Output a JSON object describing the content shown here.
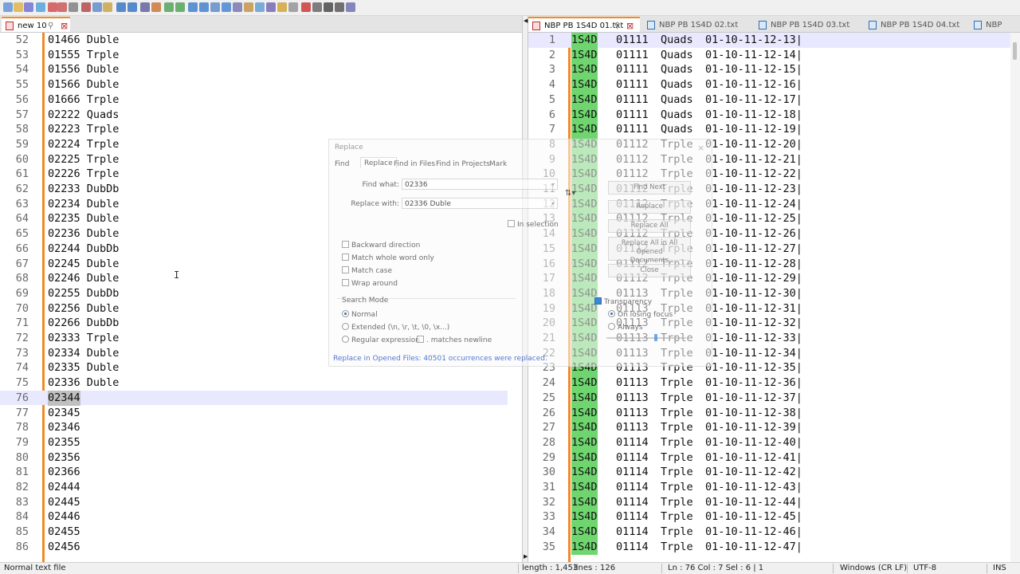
{
  "colors": {
    "accent_orange": "#f08a24",
    "highlight_green": "#6fd66f",
    "status_blue": "#3758c8",
    "current_line": "#e8e8ff"
  },
  "toolbar": {
    "icons": [
      "new-file-icon",
      "open-file-icon",
      "save-icon",
      "save-all-icon",
      "close-icon",
      "close-all-icon",
      "print-icon",
      "cut-icon",
      "copy-icon",
      "paste-icon",
      "undo-icon",
      "redo-icon",
      "find-icon",
      "replace-icon",
      "zoom-in-icon",
      "zoom-out-icon",
      "sync-vertical-icon",
      "sync-horizontal-icon",
      "word-wrap-icon",
      "show-all-chars-icon",
      "indent-guide-icon",
      "language-icon",
      "doc-map-icon",
      "function-list-icon",
      "folder-workspace-icon",
      "monitoring-icon",
      "record-macro-icon",
      "stop-macro-icon",
      "play-macro-icon",
      "run-macro-icon",
      "save-macro-icon"
    ]
  },
  "left_tabs": [
    {
      "label": "new 10",
      "active": true
    }
  ],
  "right_tabs": [
    {
      "label": "NBP PB 1S4D 01.txt",
      "active": true
    },
    {
      "label": "NBP PB 1S4D 02.txt",
      "active": false
    },
    {
      "label": "NBP PB 1S4D 03.txt",
      "active": false
    },
    {
      "label": "NBP PB 1S4D 04.txt",
      "active": false
    },
    {
      "label": "NBP",
      "active": false
    }
  ],
  "left_editor": {
    "current_line": "76",
    "lines": [
      {
        "n": "52",
        "text": "01466 Duble"
      },
      {
        "n": "53",
        "text": "01555 Trple"
      },
      {
        "n": "54",
        "text": "01556 Duble"
      },
      {
        "n": "55",
        "text": "01566 Duble"
      },
      {
        "n": "56",
        "text": "01666 Trple"
      },
      {
        "n": "57",
        "text": "02222 Quads"
      },
      {
        "n": "58",
        "text": "02223 Trple"
      },
      {
        "n": "59",
        "text": "02224 Trple"
      },
      {
        "n": "60",
        "text": "02225 Trple"
      },
      {
        "n": "61",
        "text": "02226 Trple"
      },
      {
        "n": "62",
        "text": "02233 DubDb"
      },
      {
        "n": "63",
        "text": "02234 Duble"
      },
      {
        "n": "64",
        "text": "02235 Duble"
      },
      {
        "n": "65",
        "text": "02236 Duble"
      },
      {
        "n": "66",
        "text": "02244 DubDb"
      },
      {
        "n": "67",
        "text": "02245 Duble"
      },
      {
        "n": "68",
        "text": "02246 Duble"
      },
      {
        "n": "69",
        "text": "02255 DubDb"
      },
      {
        "n": "70",
        "text": "02256 Duble"
      },
      {
        "n": "71",
        "text": "02266 DubDb"
      },
      {
        "n": "72",
        "text": "02333 Trple"
      },
      {
        "n": "73",
        "text": "02334 Duble"
      },
      {
        "n": "74",
        "text": "02335 Duble"
      },
      {
        "n": "75",
        "text": "02336 Duble"
      },
      {
        "n": "76",
        "text": "02344"
      },
      {
        "n": "77",
        "text": "02345"
      },
      {
        "n": "78",
        "text": "02346"
      },
      {
        "n": "79",
        "text": "02355"
      },
      {
        "n": "80",
        "text": "02356"
      },
      {
        "n": "81",
        "text": "02366"
      },
      {
        "n": "82",
        "text": "02444"
      },
      {
        "n": "83",
        "text": "02445"
      },
      {
        "n": "84",
        "text": "02446"
      },
      {
        "n": "85",
        "text": "02455"
      },
      {
        "n": "86",
        "text": "02456"
      }
    ]
  },
  "right_editor": {
    "prefix": "1S4D",
    "lines": [
      {
        "n": "1",
        "code": "01111",
        "kind": "Quads",
        "seq": "01-10-11-12-13|"
      },
      {
        "n": "2",
        "code": "01111",
        "kind": "Quads",
        "seq": "01-10-11-12-14|"
      },
      {
        "n": "3",
        "code": "01111",
        "kind": "Quads",
        "seq": "01-10-11-12-15|"
      },
      {
        "n": "4",
        "code": "01111",
        "kind": "Quads",
        "seq": "01-10-11-12-16|"
      },
      {
        "n": "5",
        "code": "01111",
        "kind": "Quads",
        "seq": "01-10-11-12-17|"
      },
      {
        "n": "6",
        "code": "01111",
        "kind": "Quads",
        "seq": "01-10-11-12-18|"
      },
      {
        "n": "7",
        "code": "01111",
        "kind": "Quads",
        "seq": "01-10-11-12-19|"
      },
      {
        "n": "8",
        "code": "01112",
        "kind": "Trple",
        "seq": "01-10-11-12-20|"
      },
      {
        "n": "9",
        "code": "01112",
        "kind": "Trple",
        "seq": "01-10-11-12-21|"
      },
      {
        "n": "10",
        "code": "01112",
        "kind": "Trple",
        "seq": "01-10-11-12-22|"
      },
      {
        "n": "11",
        "code": "01112",
        "kind": "Trple",
        "seq": "01-10-11-12-23|"
      },
      {
        "n": "12",
        "code": "01112",
        "kind": "Trple",
        "seq": "01-10-11-12-24|"
      },
      {
        "n": "13",
        "code": "01112",
        "kind": "Trple",
        "seq": "01-10-11-12-25|"
      },
      {
        "n": "14",
        "code": "01112",
        "kind": "Trple",
        "seq": "01-10-11-12-26|"
      },
      {
        "n": "15",
        "code": "01112",
        "kind": "Trple",
        "seq": "01-10-11-12-27|"
      },
      {
        "n": "16",
        "code": "01112",
        "kind": "Trple",
        "seq": "01-10-11-12-28|"
      },
      {
        "n": "17",
        "code": "01112",
        "kind": "Trple",
        "seq": "01-10-11-12-29|"
      },
      {
        "n": "18",
        "code": "01113",
        "kind": "Trple",
        "seq": "01-10-11-12-30|"
      },
      {
        "n": "19",
        "code": "01113",
        "kind": "Trple",
        "seq": "01-10-11-12-31|"
      },
      {
        "n": "20",
        "code": "01113",
        "kind": "Trple",
        "seq": "01-10-11-12-32|"
      },
      {
        "n": "21",
        "code": "01113",
        "kind": "Trple",
        "seq": "01-10-11-12-33|"
      },
      {
        "n": "22",
        "code": "01113",
        "kind": "Trple",
        "seq": "01-10-11-12-34|"
      },
      {
        "n": "23",
        "code": "01113",
        "kind": "Trple",
        "seq": "01-10-11-12-35|"
      },
      {
        "n": "24",
        "code": "01113",
        "kind": "Trple",
        "seq": "01-10-11-12-36|"
      },
      {
        "n": "25",
        "code": "01113",
        "kind": "Trple",
        "seq": "01-10-11-12-37|"
      },
      {
        "n": "26",
        "code": "01113",
        "kind": "Trple",
        "seq": "01-10-11-12-38|"
      },
      {
        "n": "27",
        "code": "01113",
        "kind": "Trple",
        "seq": "01-10-11-12-39|"
      },
      {
        "n": "28",
        "code": "01114",
        "kind": "Trple",
        "seq": "01-10-11-12-40|"
      },
      {
        "n": "29",
        "code": "01114",
        "kind": "Trple",
        "seq": "01-10-11-12-41|"
      },
      {
        "n": "30",
        "code": "01114",
        "kind": "Trple",
        "seq": "01-10-11-12-42|"
      },
      {
        "n": "31",
        "code": "01114",
        "kind": "Trple",
        "seq": "01-10-11-12-43|"
      },
      {
        "n": "32",
        "code": "01114",
        "kind": "Trple",
        "seq": "01-10-11-12-44|"
      },
      {
        "n": "33",
        "code": "01114",
        "kind": "Trple",
        "seq": "01-10-11-12-45|"
      },
      {
        "n": "34",
        "code": "01114",
        "kind": "Trple",
        "seq": "01-10-11-12-46|"
      },
      {
        "n": "35",
        "code": "01114",
        "kind": "Trple",
        "seq": "01-10-11-12-47|"
      }
    ]
  },
  "dialog": {
    "title": "Replace",
    "close_glyph": "×",
    "tabs": [
      "Find",
      "Replace",
      "Find in Files",
      "Find in Projects",
      "Mark"
    ],
    "active_tab": "Replace",
    "find_label": "Find what:",
    "find_value": "02336",
    "replace_label": "Replace with:",
    "replace_value": "02336 Duble",
    "in_selection": "In selection",
    "buttons": {
      "find_next": "Find Next",
      "replace": "Replace",
      "replace_all": "Replace All",
      "replace_all_opened_1": "Replace All in All Opened",
      "replace_all_opened_2": "Documents",
      "close": "Close"
    },
    "options": [
      {
        "label": "Backward direction",
        "checked": false
      },
      {
        "label": "Match whole word only",
        "checked": false
      },
      {
        "label": "Match case",
        "checked": false
      },
      {
        "label": "Wrap around",
        "checked": false
      }
    ],
    "search_mode_label": "Search Mode",
    "modes": [
      {
        "label": "Normal",
        "selected": true
      },
      {
        "label": "Extended (\\n, \\r, \\t, \\0, \\x...)",
        "selected": false
      },
      {
        "label": "Regular expression",
        "selected": false
      }
    ],
    "matches_newline": ". matches newline",
    "transparency_label": "Transparency",
    "transparency_enabled": true,
    "transparency_modes": [
      {
        "label": "On losing focus",
        "selected": true
      },
      {
        "label": "Always",
        "selected": false
      }
    ],
    "transparency_level": 0.6,
    "status_message": "Replace in Opened Files: 40501 occurrences were replaced."
  },
  "statusbar": {
    "file_type": "Normal text file",
    "length": "length : 1,453",
    "lines": "lines : 126",
    "position": "Ln : 76    Col : 7    Sel : 6 | 1",
    "eol": "Windows (CR LF)",
    "encoding": "UTF-8",
    "mode": "INS"
  }
}
